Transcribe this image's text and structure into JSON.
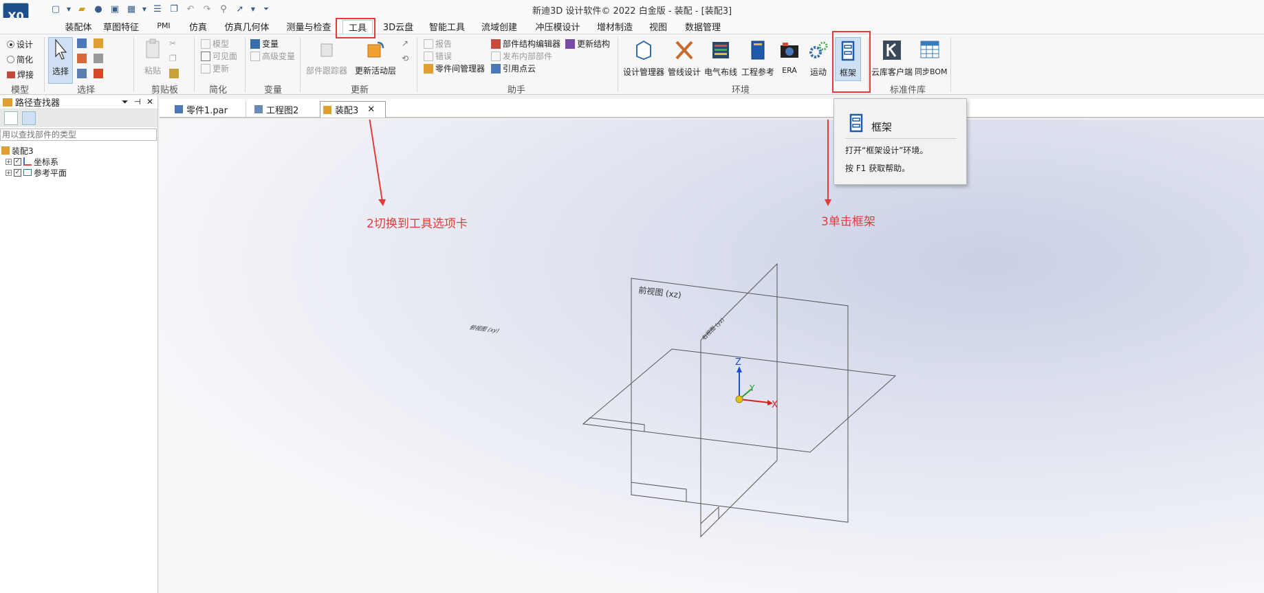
{
  "window": {
    "title": "新迪3D 设计软件© 2022 白金版 - 装配 - [装配3]",
    "logo_text": "X0"
  },
  "tabs": [
    {
      "label": "装配体"
    },
    {
      "label": "草图特征"
    },
    {
      "label": "PMI"
    },
    {
      "label": "仿真"
    },
    {
      "label": "仿真几何体"
    },
    {
      "label": "测量与检查"
    },
    {
      "label": "工具"
    },
    {
      "label": "3D云盘"
    },
    {
      "label": "智能工具"
    },
    {
      "label": "流域创建"
    },
    {
      "label": "冲压模设计"
    },
    {
      "label": "增材制造"
    },
    {
      "label": "视图"
    },
    {
      "label": "数据管理"
    }
  ],
  "ribbon": {
    "model": {
      "design": "设计",
      "simplify": "简化",
      "weld": "焊接",
      "group": "模型"
    },
    "select": {
      "label": "选择",
      "group": "选择"
    },
    "clipboard": {
      "paste": "粘贴",
      "group": "剪贴板"
    },
    "simplify": {
      "model": "模型",
      "visible_face": "可见面",
      "update": "更新",
      "group": "简化"
    },
    "variables": {
      "variable": "变量",
      "advanced_variable": "高级变量",
      "group": "变量"
    },
    "update": {
      "part_tracker": "部件跟踪器",
      "update_active_layer": "更新活动层",
      "group": "更新"
    },
    "assistant": {
      "report": "报告",
      "errors": "错误",
      "part_manager": "零件间管理器",
      "structure_editor": "部件结构编辑器",
      "publish_internal": "发布内部部件",
      "reference_cloud": "引用点云",
      "update_structure": "更新结构",
      "group": "助手"
    },
    "environment": {
      "design_manager": "设计管理器",
      "pipe_design": "管线设计",
      "electrical": "电气布线",
      "eng_reference": "工程参考",
      "era": "ERA",
      "motion": "运动",
      "frame": "框架",
      "group": "环境"
    },
    "std_parts": {
      "cloud_client": "云库客户端",
      "sync_bom": "同步BOM",
      "group": "标准件库"
    }
  },
  "pathfinder": {
    "title": "路径查找器",
    "search_placeholder": "用以查找部件的类型",
    "tree": [
      {
        "label": "装配3"
      },
      {
        "label": "坐标系"
      },
      {
        "label": "参考平面"
      }
    ]
  },
  "doc_tabs": [
    {
      "label": "零件1.par"
    },
    {
      "label": "工程图2"
    },
    {
      "label": "装配3"
    }
  ],
  "viewport": {
    "front_plane": "前视图 (xz)",
    "right_plane": "右视图 (yz)",
    "top_plane": "俯视图 (xy)",
    "axis_x": "X",
    "axis_y": "Y",
    "axis_z": "Z"
  },
  "annotations": {
    "step2": "2切换到工具选项卡",
    "step3": "3单击框架"
  },
  "tooltip": {
    "title": "框架",
    "description": "打开“框架设计”环境。",
    "help": "按 F1 获取帮助。"
  },
  "colors": {
    "annotation": "#e23b3b",
    "accent": "#1e5aa8"
  }
}
